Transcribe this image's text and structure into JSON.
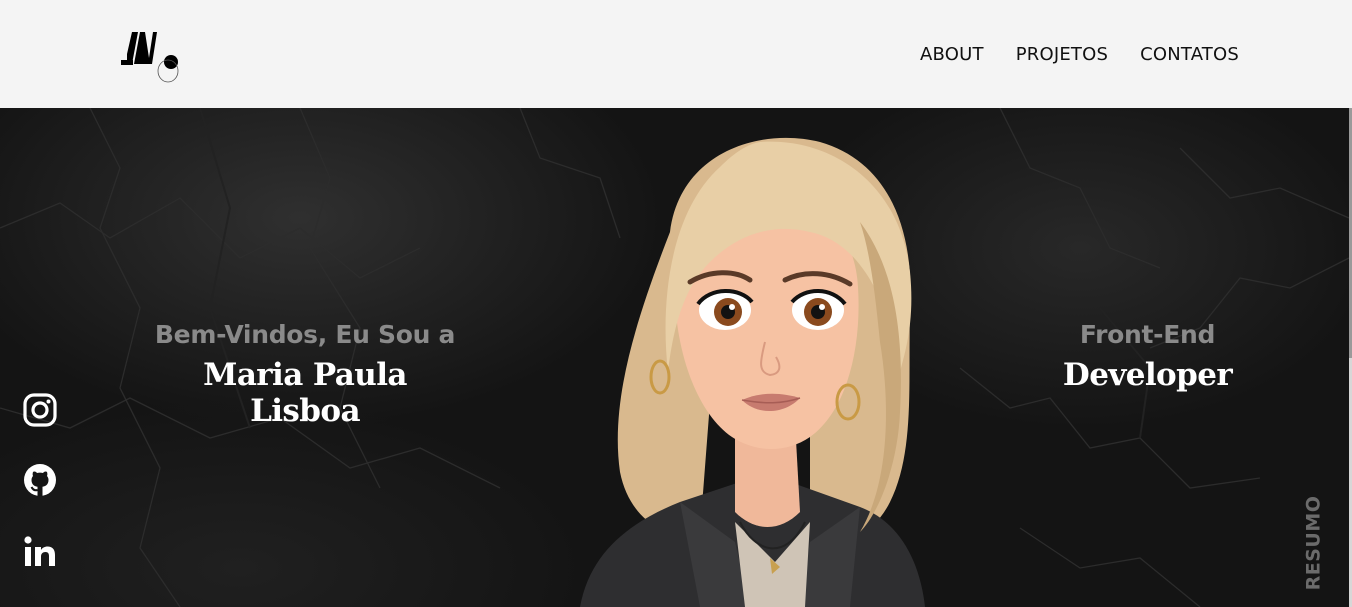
{
  "header": {
    "logo_icon": "mp-monogram-logo",
    "nav": [
      {
        "label": "ABOUT"
      },
      {
        "label": "PROJETOS"
      },
      {
        "label": "CONTATOS"
      }
    ]
  },
  "hero": {
    "greeting": "Bem-Vindos, Eu Sou a",
    "name": "Maria Paula Lisboa",
    "role_top": "Front-End",
    "role_bottom": "Developer",
    "resume_label": "RESUMO",
    "portrait": "cartoon-woman-portrait",
    "social_icons": [
      "instagram-icon",
      "github-icon",
      "linkedin-icon"
    ]
  },
  "colors": {
    "header_bg": "#f4f4f4",
    "hero_bg": "#141414",
    "greeting_text": "#8a8a8a",
    "name_text": "#ffffff",
    "resume_text": "#6b6b6b"
  }
}
